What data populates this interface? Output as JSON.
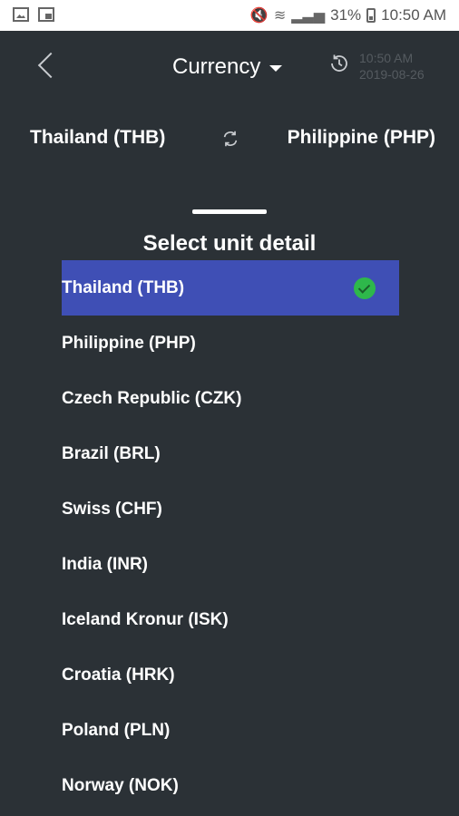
{
  "status_bar": {
    "battery": "31%",
    "time": "10:50 AM"
  },
  "header": {
    "title": "Currency",
    "timestamp_time": "10:50 AM",
    "timestamp_date": "2019-08-26"
  },
  "conversion": {
    "from": "Thailand (THB)",
    "to": "Philippine (PHP)"
  },
  "sheet": {
    "title": "Select unit detail",
    "items": [
      {
        "label": "Thailand (THB)",
        "selected": true
      },
      {
        "label": "Philippine (PHP)",
        "selected": false
      },
      {
        "label": "Czech Republic (CZK)",
        "selected": false
      },
      {
        "label": "Brazil (BRL)",
        "selected": false
      },
      {
        "label": "Swiss (CHF)",
        "selected": false
      },
      {
        "label": "India (INR)",
        "selected": false
      },
      {
        "label": "Iceland Kronur (ISK)",
        "selected": false
      },
      {
        "label": "Croatia (HRK)",
        "selected": false
      },
      {
        "label": "Poland (PLN)",
        "selected": false
      },
      {
        "label": "Norway (NOK)",
        "selected": false
      }
    ]
  },
  "colors": {
    "background": "#2b3136",
    "selected": "#3f4fb5",
    "check": "#2eb84b"
  }
}
